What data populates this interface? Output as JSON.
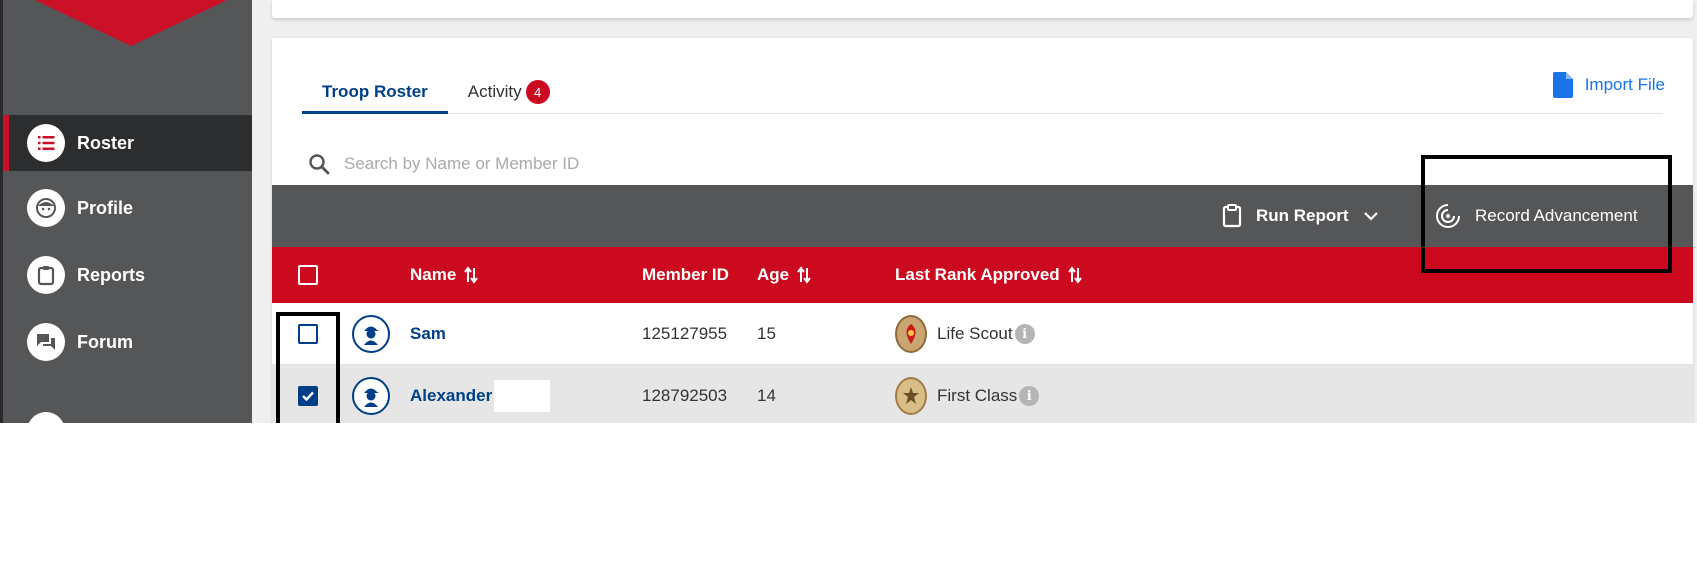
{
  "sidebar": {
    "items": [
      {
        "label": "Roster",
        "icon": "list-icon",
        "active": true
      },
      {
        "label": "Profile",
        "icon": "face-icon",
        "active": false
      },
      {
        "label": "Reports",
        "icon": "clipboard-icon",
        "active": false
      },
      {
        "label": "Forum",
        "icon": "chat-icon",
        "active": false
      }
    ]
  },
  "tabs": [
    {
      "label": "Troop Roster",
      "active": true
    },
    {
      "label": "Activity",
      "badge": "4",
      "active": false
    }
  ],
  "import_label": "Import File",
  "search": {
    "placeholder": "Search by Name or Member ID",
    "value": ""
  },
  "toolbar": {
    "run_report": "Run Report",
    "record_advancement": "Record Advancement"
  },
  "table": {
    "columns": {
      "name": "Name",
      "member_id": "Member ID",
      "age": "Age",
      "last_rank": "Last Rank Approved"
    },
    "rows": [
      {
        "name": "Sam",
        "member_id": "125127955",
        "age": "15",
        "rank": "Life Scout",
        "checked": false
      },
      {
        "name": "Alexander",
        "member_id": "128792503",
        "age": "14",
        "rank": "First Class",
        "checked": true
      }
    ]
  },
  "colors": {
    "brand_red": "#cc0a1f",
    "navy": "#003f87",
    "sidebar": "#555658",
    "link_blue": "#1a73e8"
  }
}
